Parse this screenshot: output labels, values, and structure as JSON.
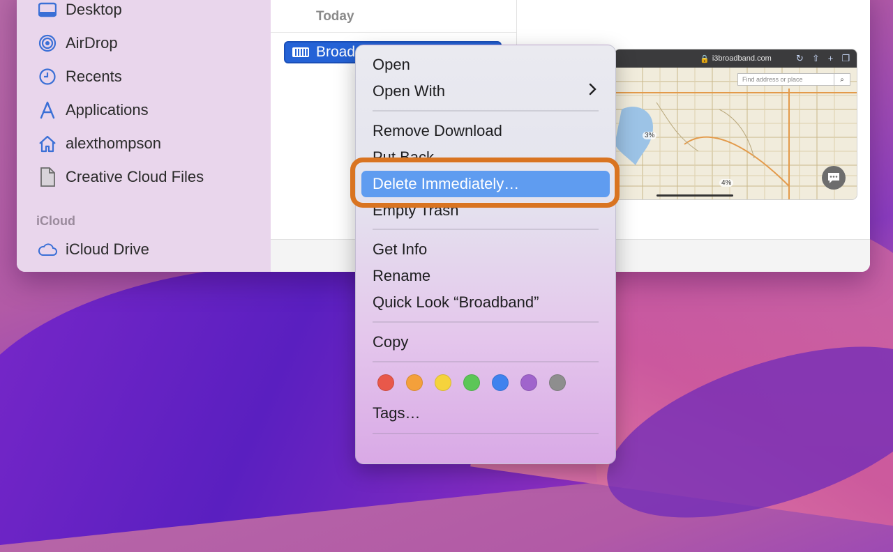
{
  "sidebar": {
    "items": [
      {
        "label": "Desktop",
        "icon": "desktop-icon"
      },
      {
        "label": "AirDrop",
        "icon": "airdrop-icon"
      },
      {
        "label": "Recents",
        "icon": "clock-icon"
      },
      {
        "label": "Applications",
        "icon": "applications-icon"
      },
      {
        "label": "alexthompson",
        "icon": "home-icon"
      },
      {
        "label": "Creative Cloud Files",
        "icon": "document-icon"
      }
    ],
    "icloud_heading": "iCloud",
    "icloud_item": {
      "label": "iCloud Drive",
      "icon": "cloud-icon"
    }
  },
  "list": {
    "group_header": "Today",
    "selected_file": "Broad"
  },
  "preview": {
    "url": "i3broadband.com",
    "search_placeholder": "Find address or place",
    "badges": [
      "3%",
      "4%"
    ]
  },
  "context_menu": {
    "open": "Open",
    "open_with": "Open With",
    "remove_download": "Remove Download",
    "put_back": "Put Back",
    "delete_immediately": "Delete Immediately…",
    "empty_trash": "Empty Trash",
    "get_info": "Get Info",
    "rename": "Rename",
    "quick_look": "Quick Look “Broadband”",
    "copy": "Copy",
    "tags": "Tags…",
    "tag_colors": [
      "#e8584a",
      "#f4a03b",
      "#f5d33c",
      "#5cc657",
      "#3f82ee",
      "#a064cc",
      "#8e8e8e"
    ]
  },
  "colors": {
    "selection": "#2462d6",
    "menu_highlight": "#5f9cf0",
    "annotation_ring": "#d97421"
  }
}
